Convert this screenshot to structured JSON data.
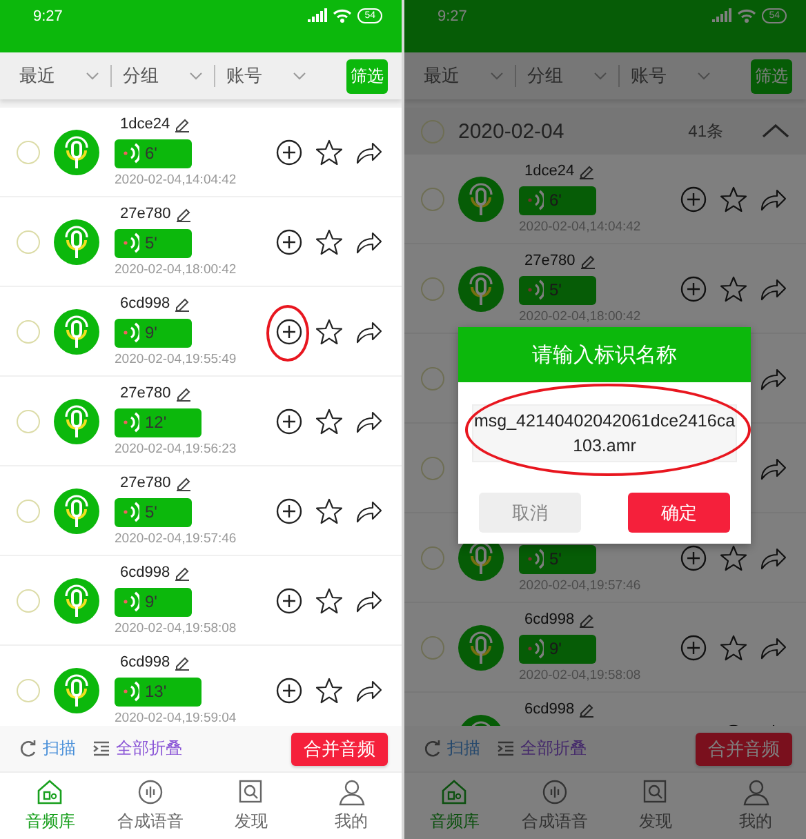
{
  "screens": [
    {
      "status_bar": {
        "time": "9:27",
        "battery": "54"
      },
      "filters": [
        {
          "label": "最近"
        },
        {
          "label": "分组"
        },
        {
          "label": "账号"
        }
      ],
      "filter_button": "筛选",
      "recordings": [
        {
          "name": "1dce24",
          "duration": "6'",
          "time": "2020-02-04,14:04:42",
          "checked": false,
          "annotated": false
        },
        {
          "name": "27e780",
          "duration": "5'",
          "time": "2020-02-04,18:00:42",
          "checked": false,
          "annotated": false
        },
        {
          "name": "6cd998",
          "duration": "9'",
          "time": "2020-02-04,19:55:49",
          "checked": false,
          "annotated": true
        },
        {
          "name": "27e780",
          "duration": "12'",
          "time": "2020-02-04,19:56:23",
          "checked": false,
          "annotated": false
        },
        {
          "name": "27e780",
          "duration": "5'",
          "time": "2020-02-04,19:57:46",
          "checked": false,
          "annotated": false
        },
        {
          "name": "6cd998",
          "duration": "9'",
          "time": "2020-02-04,19:58:08",
          "checked": false,
          "annotated": false
        },
        {
          "name": "6cd998",
          "duration": "13'",
          "time": "2020-02-04,19:59:04",
          "checked": false,
          "annotated": false
        }
      ],
      "toolbar": {
        "scan": "扫描",
        "collapse": "全部折叠",
        "merge": "合并音频"
      },
      "tabs": [
        {
          "label": "音频库",
          "selected": true
        },
        {
          "label": "合成语音",
          "selected": false
        },
        {
          "label": "发现",
          "selected": false
        },
        {
          "label": "我的",
          "selected": false
        }
      ]
    },
    {
      "status_bar": {
        "time": "9:27",
        "battery": "54"
      },
      "filters": [
        {
          "label": "最近"
        },
        {
          "label": "分组"
        },
        {
          "label": "账号"
        }
      ],
      "filter_button": "筛选",
      "group": {
        "date": "2020-02-04",
        "count": "41条",
        "checked": false,
        "expanded": true
      },
      "recordings": [
        {
          "name": "1dce24",
          "duration": "6'",
          "time": "2020-02-04,14:04:42",
          "checked": false,
          "annotated": false
        },
        {
          "name": "27e780",
          "duration": "5'",
          "time": "2020-02-04,18:00:42",
          "checked": false,
          "annotated": false
        },
        {
          "checked": false,
          "annotated": false
        },
        {
          "checked": false,
          "annotated": false
        },
        {
          "duration": "5'",
          "time": "2020-02-04,19:57:46",
          "checked": false,
          "annotated": false
        },
        {
          "name": "6cd998",
          "duration": "9'",
          "time": "2020-02-04,19:58:08",
          "checked": false,
          "annotated": false
        },
        {
          "name": "6cd998",
          "annotated": false
        }
      ],
      "toolbar": {
        "scan": "扫描",
        "collapse": "全部折叠",
        "merge": "合并音频"
      },
      "tabs": [
        {
          "label": "音频库",
          "selected": true
        },
        {
          "label": "合成语音",
          "selected": false
        },
        {
          "label": "发现",
          "selected": false
        },
        {
          "label": "我的",
          "selected": false
        }
      ],
      "dialog": {
        "title": "请输入标识名称",
        "value": "msg_42140402042061dce2416ca103.amr",
        "annotated": true,
        "cancel": "取消",
        "confirm": "确定"
      }
    }
  ]
}
